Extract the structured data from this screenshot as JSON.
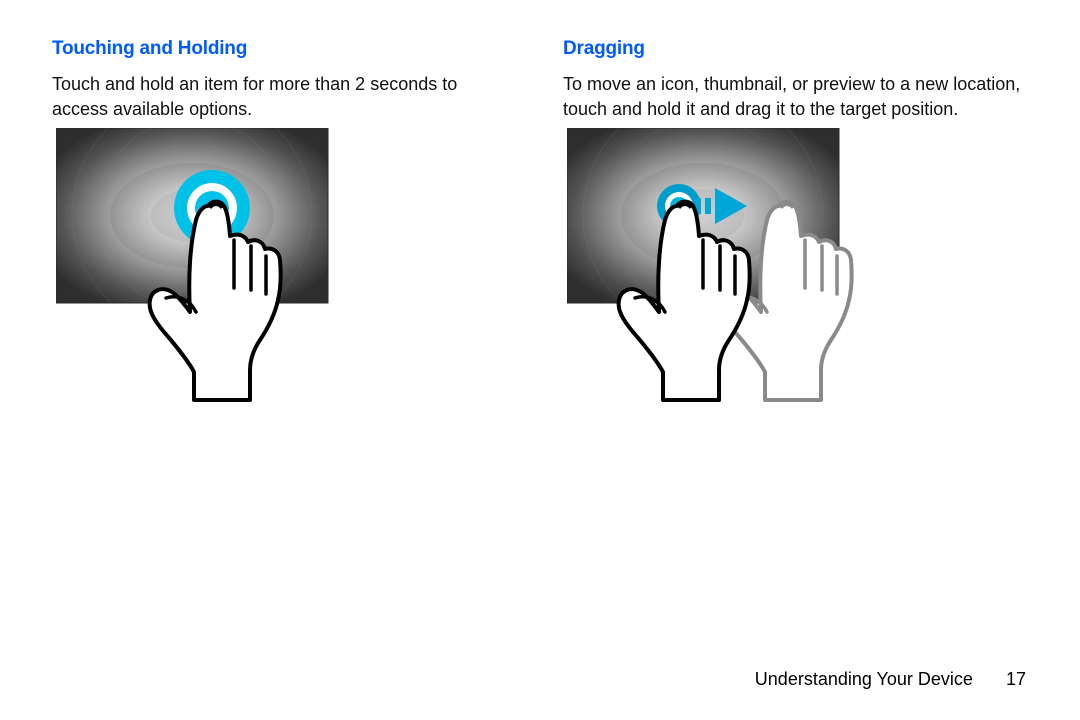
{
  "left": {
    "heading": "Touching and Holding",
    "body": "Touch and hold an item for more than 2 seconds to access available options."
  },
  "right": {
    "heading": "Dragging",
    "body": "To move an icon, thumbnail, or preview to a new location, touch and hold it and drag it to the target position."
  },
  "footer": {
    "section": "Understanding Your Device",
    "page": "17"
  },
  "colors": {
    "accent": "#00B6E0",
    "accent_dark": "#0093C4",
    "heading_blue": "#005aff"
  }
}
